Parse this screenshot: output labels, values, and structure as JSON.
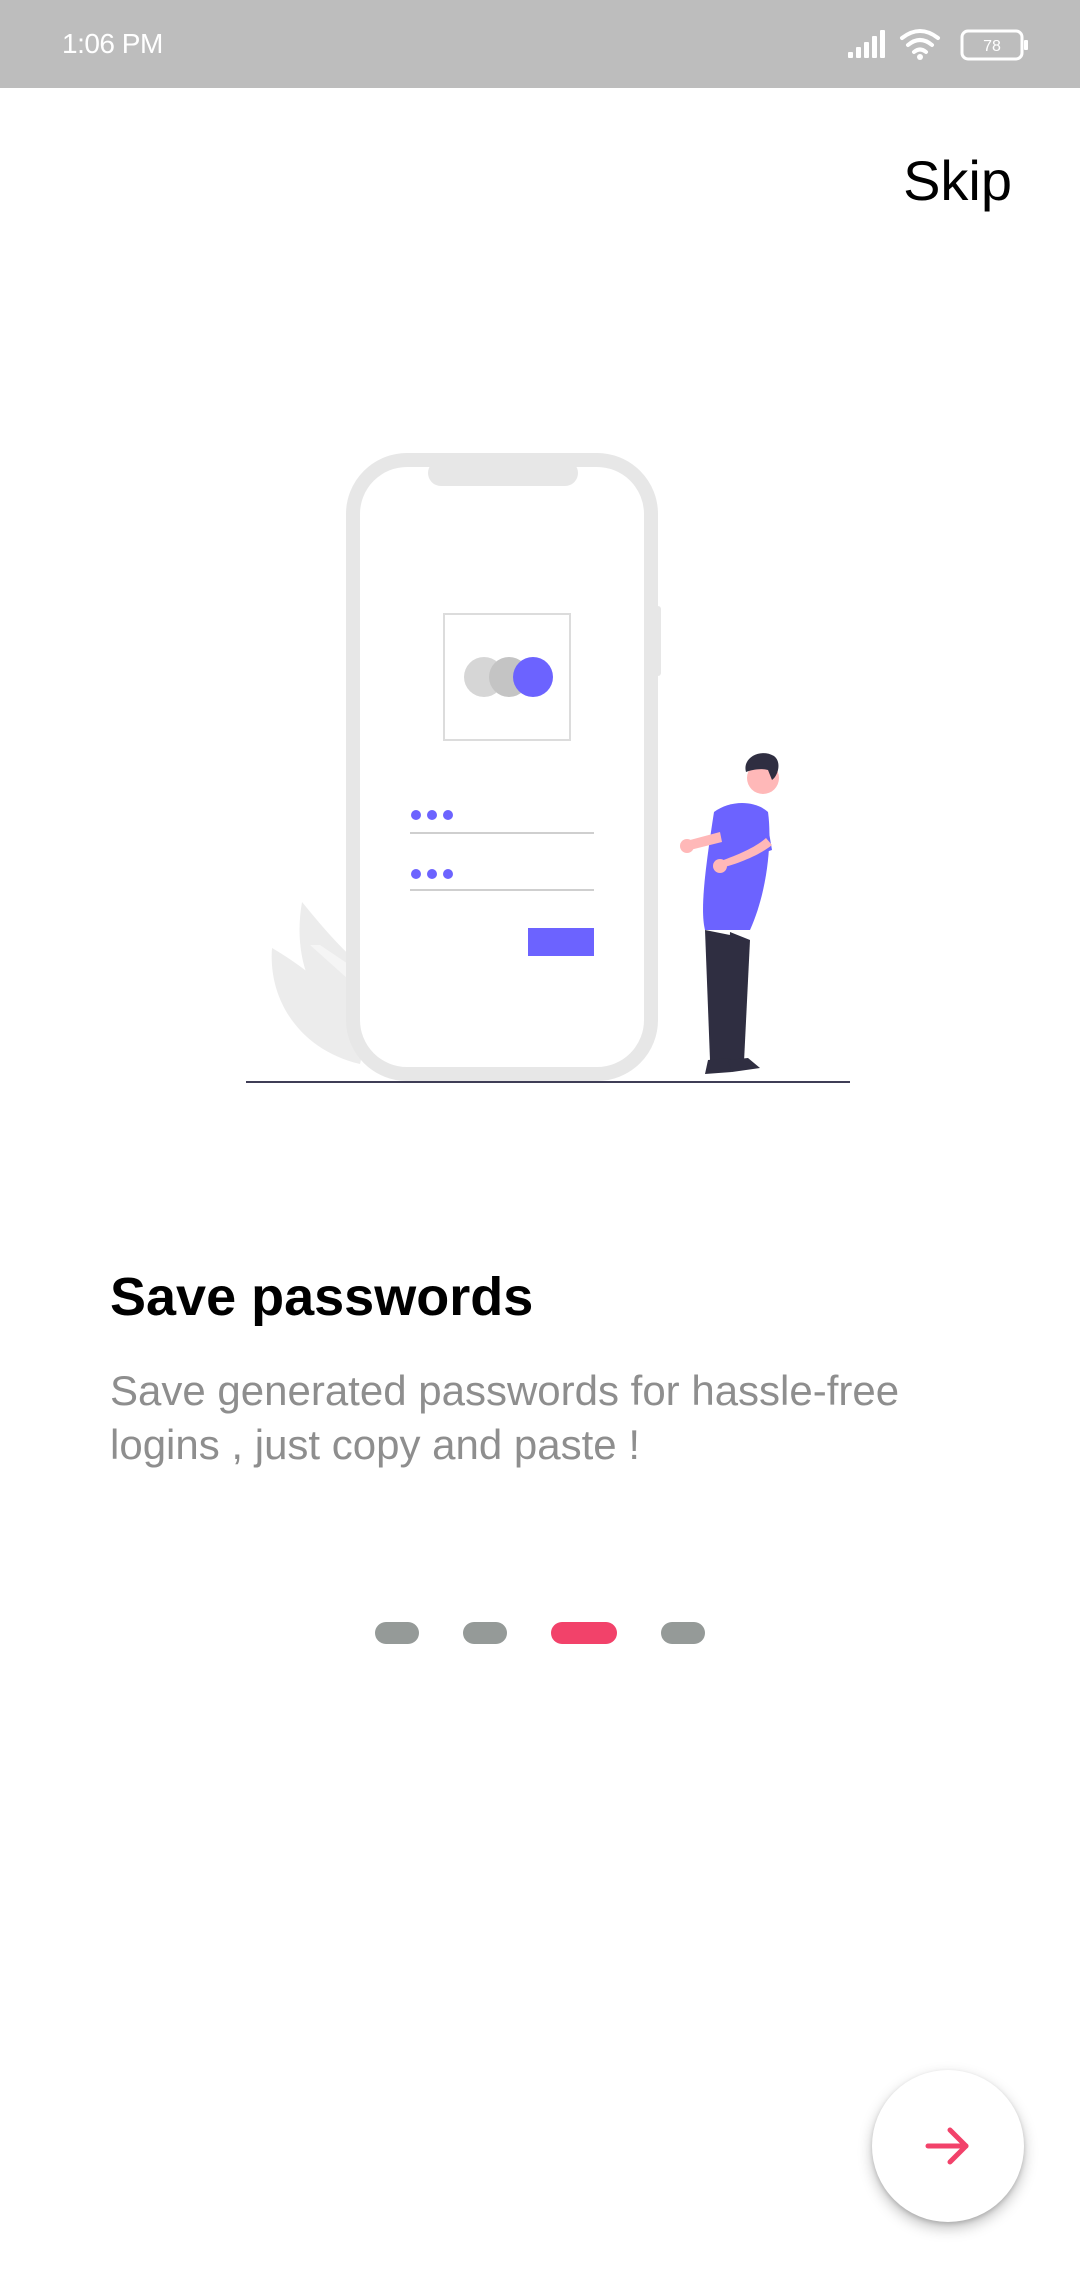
{
  "status_bar": {
    "time": "1:06 PM",
    "battery": "78"
  },
  "skip_label": "Skip",
  "onboarding": {
    "title": "Save passwords",
    "description": "Save generated passwords for hassle-free logins , just copy and paste !",
    "page_count": 4,
    "active_page": 3
  },
  "colors": {
    "accent": "#f2426a",
    "illustration_purple": "#6c63ff",
    "dot_inactive": "#959a98",
    "status_bar_bg": "#bdbdbd"
  },
  "icons": {
    "next": "arrow-right-icon",
    "signal": "signal-icon",
    "wifi": "wifi-icon",
    "battery": "battery-icon"
  }
}
